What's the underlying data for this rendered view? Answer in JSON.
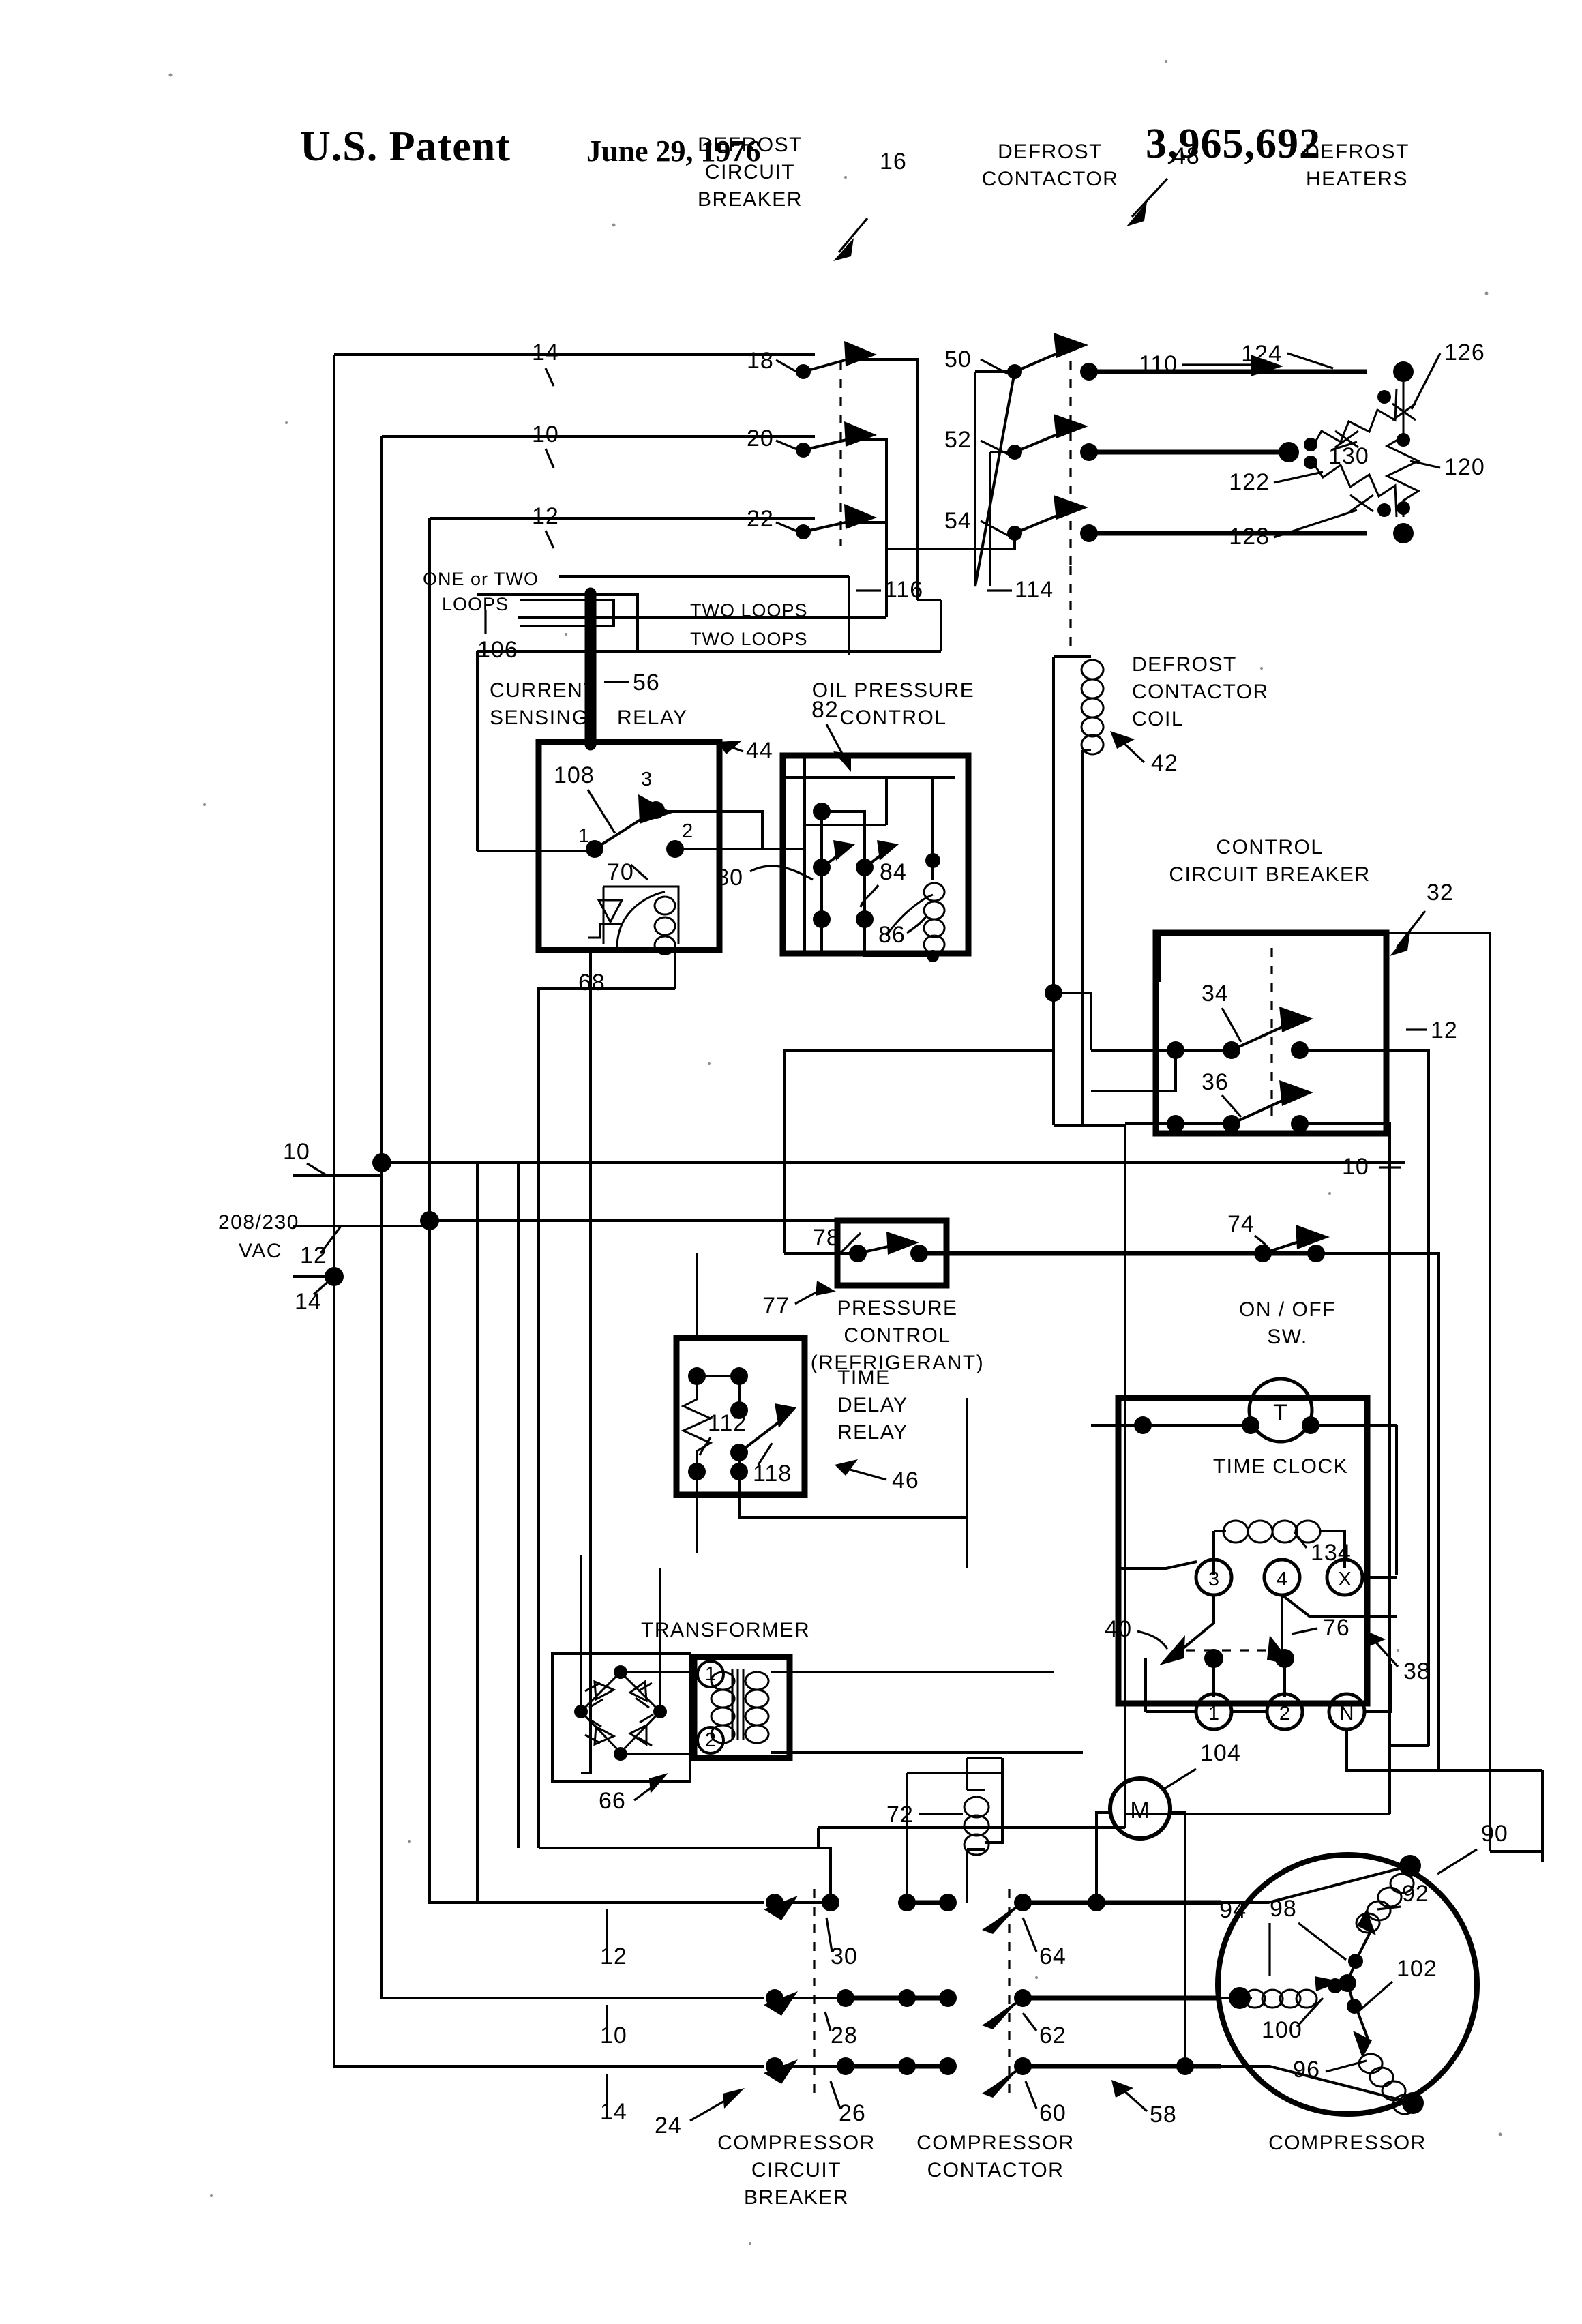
{
  "header": {
    "patent_office": "U.S. Patent",
    "date": "June 29, 1976",
    "patent_number": "3,965,692"
  },
  "figure": {
    "supply_label_line1": "208/230",
    "supply_label_line2": "VAC",
    "blocks": {
      "defrost_circuit_breaker": "DEFROST\nCIRCUIT\nBREAKER",
      "defrost_circuit_breaker_l1": "DEFROST",
      "defrost_circuit_breaker_l2": "CIRCUIT",
      "defrost_circuit_breaker_l3": "BREAKER",
      "defrost_contactor_l1": "DEFROST",
      "defrost_contactor_l2": "CONTACTOR",
      "defrost_heaters_l1": "DEFROST",
      "defrost_heaters_l2": "HEATERS",
      "one_or_two_loops_l1": "ONE or TWO",
      "one_or_two_loops_l2": "LOOPS",
      "two_loops_a": "TWO LOOPS",
      "two_loops_b": "TWO LOOPS",
      "current_sensing_relay_l1": "CURRENT",
      "current_sensing_relay_l2": "SENSING",
      "current_sensing_relay_l3": "RELAY",
      "oil_pressure_control_l1": "OIL PRESSURE",
      "oil_pressure_control_l2": "CONTROL",
      "defrost_contactor_coil_l1": "DEFROST",
      "defrost_contactor_coil_l2": "CONTACTOR",
      "defrost_contactor_coil_l3": "COIL",
      "control_circuit_breaker_l1": "CONTROL",
      "control_circuit_breaker_l2": "CIRCUIT BREAKER",
      "pressure_control_l1": "PRESSURE",
      "pressure_control_l2": "CONTROL",
      "pressure_control_l3": "(REFRIGERANT)",
      "on_off_sw_l1": "ON / OFF",
      "on_off_sw_l2": "SW.",
      "time_delay_relay_l1": "TIME",
      "time_delay_relay_l2": "DELAY",
      "time_delay_relay_l3": "RELAY",
      "time_clock": "TIME CLOCK",
      "transformer": "TRANSFORMER",
      "compressor_circuit_breaker_l1": "COMPRESSOR",
      "compressor_circuit_breaker_l2": "CIRCUIT",
      "compressor_circuit_breaker_l3": "BREAKER",
      "compressor_contactor_l1": "COMPRESSOR",
      "compressor_contactor_l2": "CONTACTOR",
      "compressor": "COMPRESSOR"
    },
    "terminal_marks": {
      "t_motor": "T",
      "t1": "1",
      "t2": "2",
      "t3": "3",
      "t4": "4",
      "tx": "X",
      "tn": "N",
      "xfmr_1": "1",
      "xfmr_2": "2",
      "csr_1": "1",
      "csr_2": "2",
      "csr_3": "3",
      "motor_m": "M"
    },
    "reference_numerals": {
      "n10_top": "10",
      "n12_top": "12",
      "n14_top": "14",
      "n16": "16",
      "n18": "18",
      "n20": "20",
      "n22": "22",
      "n24": "24",
      "n26": "26",
      "n28": "28",
      "n30": "30",
      "n32": "32",
      "n34": "34",
      "n36": "36",
      "n38": "38",
      "n40": "40",
      "n42": "42",
      "n44": "44",
      "n46": "46",
      "n48": "48",
      "n50": "50",
      "n52": "52",
      "n54": "54",
      "n56": "56",
      "n58": "58",
      "n60": "60",
      "n62": "62",
      "n64": "64",
      "n66": "66",
      "n68": "68",
      "n70": "70",
      "n72": "72",
      "n74": "74",
      "n76": "76",
      "n77": "77",
      "n78": "78",
      "n80": "80",
      "n82": "82",
      "n84": "84",
      "n86": "86",
      "n90": "90",
      "n92": "92",
      "n94": "94",
      "n96": "96",
      "n98": "98",
      "n100": "100",
      "n102": "102",
      "n104": "104",
      "n106": "106",
      "n108": "108",
      "n110": "110",
      "n112": "112",
      "n114": "114",
      "n116": "116",
      "n118": "118",
      "n120": "120",
      "n122": "122",
      "n124": "124",
      "n126": "126",
      "n128": "128",
      "n130": "130",
      "n134": "134",
      "n10_left": "10",
      "n12_left": "12",
      "n14_left": "14",
      "n12_ccb": "12",
      "n10_ccb": "10",
      "n12_bot": "12",
      "n10_bot": "10",
      "n14_bot": "14"
    }
  }
}
